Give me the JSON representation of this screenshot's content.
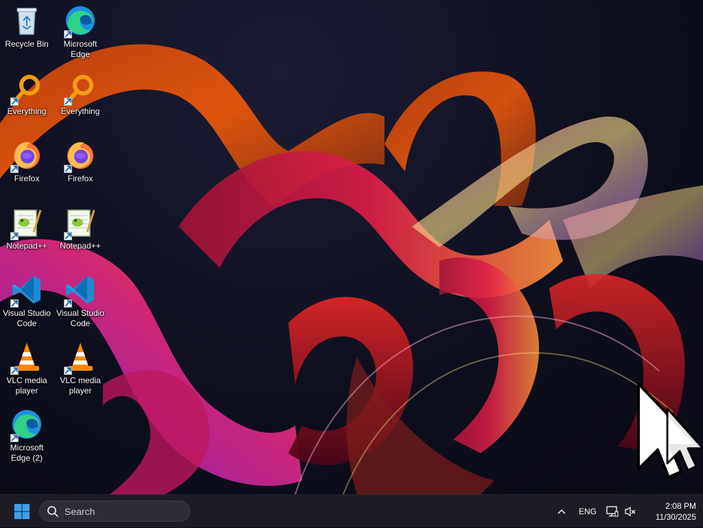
{
  "desktop": {
    "icons": [
      {
        "label": "Recycle Bin",
        "icon": "recycle-bin-icon",
        "shortcut": false
      },
      {
        "label": "Microsoft Edge",
        "icon": "edge-icon",
        "shortcut": true
      },
      {
        "label": "Everything",
        "icon": "everything-icon",
        "shortcut": true
      },
      {
        "label": "Everything",
        "icon": "everything-icon",
        "shortcut": true
      },
      {
        "label": "Firefox",
        "icon": "firefox-icon",
        "shortcut": true
      },
      {
        "label": "Firefox",
        "icon": "firefox-icon",
        "shortcut": true
      },
      {
        "label": "Notepad++",
        "icon": "notepadpp-icon",
        "shortcut": true
      },
      {
        "label": "Notepad++",
        "icon": "notepadpp-icon",
        "shortcut": true
      },
      {
        "label": "Visual Studio Code",
        "icon": "vscode-icon",
        "shortcut": true
      },
      {
        "label": "Visual Studio Code",
        "icon": "vscode-icon",
        "shortcut": true
      },
      {
        "label": "VLC media player",
        "icon": "vlc-icon",
        "shortcut": true
      },
      {
        "label": "VLC media player",
        "icon": "vlc-icon",
        "shortcut": true
      },
      {
        "label": "Microsoft Edge (2)",
        "icon": "edge-icon",
        "shortcut": true
      }
    ]
  },
  "taskbar": {
    "start_icon": "windows-start-icon",
    "search_placeholder": "Search",
    "tray": {
      "language": "ENG",
      "time": "2:08 PM",
      "date": "11/30/2025"
    }
  },
  "colors": {
    "taskbar_bg": "#1c1d24",
    "accent_blue": "#3aa0f0"
  }
}
